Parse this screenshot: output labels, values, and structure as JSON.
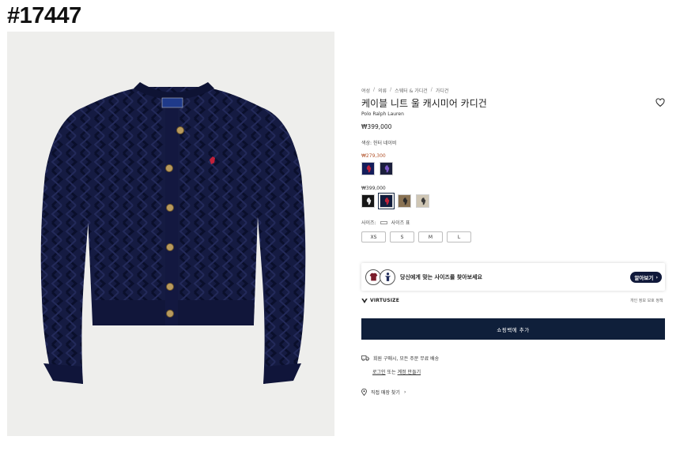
{
  "id_tag": "#17447",
  "breadcrumb": [
    "여성",
    "의류",
    "스웨터 & 가디건",
    "가디건"
  ],
  "product": {
    "title": "케이블 니트 울 캐시미어 카디건",
    "brand": "Polo Ralph Lauren",
    "price": "₩399,000"
  },
  "color": {
    "label": "색상: 헌터 네이비",
    "sale_price": "₩279,300",
    "regular_price": "₩399,000",
    "sale_swatches": [
      {
        "color": "#141d5a",
        "pony": "#c0213a"
      },
      {
        "color": "#1b1f3c",
        "pony": "#7a57c6"
      }
    ],
    "regular_swatches": [
      {
        "color": "#161616",
        "pony": "#e8e8e8"
      },
      {
        "color": "#101c3d",
        "pony": "#c0213a",
        "selected": true
      },
      {
        "color": "#8a7354",
        "pony": "#2b2b2b"
      },
      {
        "color": "#cfc6b4",
        "pony": "#3a3a3a"
      }
    ]
  },
  "size": {
    "label": "사이즈:",
    "guide": "사이즈 표",
    "options": [
      "XS",
      "S",
      "M",
      "L"
    ]
  },
  "virtusize": {
    "message": "당신에게 맞는 사이즈를 찾아보세요",
    "button": "알아보기",
    "logo": "VIRTUSIZE",
    "policy": "개인 정보 보호 정책"
  },
  "add_to_cart": "쇼핑백에 추가",
  "shipping": {
    "text": "회원 구매시, 모든 주문 무료 배송",
    "login": "로그인",
    "or": "또는",
    "signup": "계정 만들기"
  },
  "store": "직접 매장 찾기",
  "colors": {
    "navy_button": "#0f1f3a",
    "sweater": "#141a3f",
    "sale_price": "#b2532a"
  }
}
